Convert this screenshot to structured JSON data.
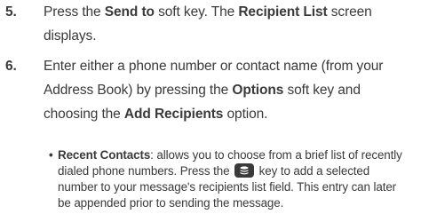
{
  "steps": [
    {
      "number": "5.",
      "lines": [
        [
          {
            "t": "Press the ",
            "b": false
          },
          {
            "t": "Send to",
            "b": true
          },
          {
            "t": " soft key. The ",
            "b": false
          },
          {
            "t": "Recipient List",
            "b": true
          },
          {
            "t": " screen",
            "b": false
          }
        ],
        [
          {
            "t": "displays.",
            "b": false
          }
        ]
      ]
    },
    {
      "number": "6.",
      "lines": [
        [
          {
            "t": "Enter either a phone number or contact name (from your",
            "b": false
          }
        ],
        [
          {
            "t": "Address Book) by pressing the ",
            "b": false
          },
          {
            "t": "Options",
            "b": true
          },
          {
            "t": " soft key and",
            "b": false
          }
        ],
        [
          {
            "t": "choosing the ",
            "b": false
          },
          {
            "t": "Add Recipients",
            "b": true
          },
          {
            "t": " option.",
            "b": false
          }
        ]
      ]
    }
  ],
  "bullet": {
    "marker": "•",
    "term": "Recent Contacts",
    "line1_rest": ": allows you to choose from a brief list of recently",
    "line2_before_icon": "dialed phone numbers. Press the ",
    "line2_after_icon": " key to add a selected",
    "line3": "number to your message's recipients list field. This entry can later",
    "line4": "be appended prior to sending the message.",
    "key_icon": "menu-ok-key-icon"
  }
}
